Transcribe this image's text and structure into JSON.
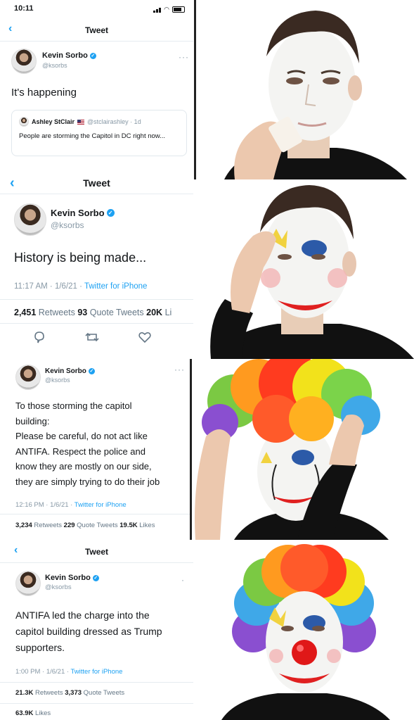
{
  "colors": {
    "twitter_blue": "#1da1f2",
    "text": "#14171a",
    "muted": "#8899a6"
  },
  "panel1": {
    "status_time": "10:11",
    "title": "Tweet",
    "author_name": "Kevin Sorbo",
    "author_handle": "@ksorbs",
    "text": "It's happening",
    "quote_author": "Ashley StClair",
    "quote_handle_time": "@stclairashley · 1d",
    "quote_text": "People are storming the Capitol in DC right now..."
  },
  "panel2": {
    "title": "Tweet",
    "author_name": "Kevin Sorbo",
    "author_handle": "@ksorbs",
    "text": "History is being made...",
    "meta_time": "11:17 AM · 1/6/21 · ",
    "meta_source": "Twitter for iPhone",
    "retweets": "2,451",
    "retweets_label": "Retweets",
    "quotes": "93",
    "quotes_label": "Quote Tweets",
    "likes": "20K",
    "likes_label": "Li"
  },
  "panel3": {
    "author_name": "Kevin Sorbo",
    "author_handle": "@ksorbs",
    "lines": [
      "To those storming the capitol",
      "building:",
      "Please be careful, do not act like",
      "ANTIFA. Respect the police and",
      "know they are mostly on our side,",
      "they are simply trying to do their job"
    ],
    "meta_time": "12:16 PM · 1/6/21 · ",
    "meta_source": "Twitter for iPhone",
    "retweets": "3,234",
    "retweets_label": "Retweets",
    "quotes": "229",
    "quotes_label": "Quote Tweets",
    "likes": "19.5K",
    "likes_label": "Likes"
  },
  "panel4": {
    "title": "Tweet",
    "author_name": "Kevin Sorbo",
    "author_handle": "@ksorbs",
    "lines": [
      "ANTIFA led the charge into the",
      "capitol building dressed as Trump",
      "supporters."
    ],
    "meta_time": "1:00 PM · 1/6/21 · ",
    "meta_source": "Twitter for iPhone",
    "retweets": "21.3K",
    "retweets_label": "Retweets",
    "quotes": "3,373",
    "quotes_label": "Quote Tweets",
    "likes": "63.9K",
    "likes_label": "Likes"
  },
  "icons": [
    "back-chevron-icon",
    "verified-badge-icon",
    "more-dots-icon",
    "reply-icon",
    "retweet-icon",
    "like-icon",
    "signal-icon",
    "wifi-icon",
    "battery-icon",
    "flag-icon"
  ]
}
